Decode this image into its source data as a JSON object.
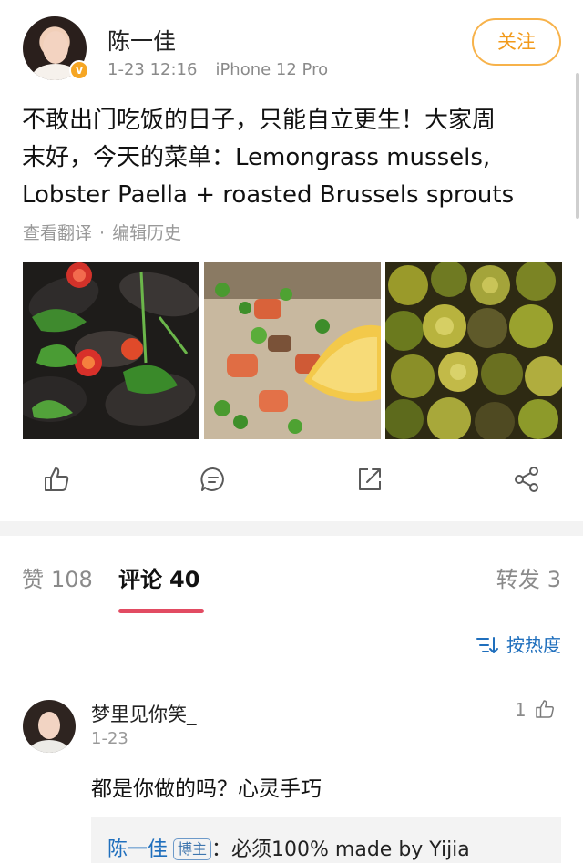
{
  "post": {
    "author": "陈一佳",
    "time": "1-23 12:16",
    "device": "iPhone 12 Pro",
    "follow_label": "关注",
    "verified_badge": "v",
    "text_lines": [
      "不敢出门吃饭的日子，只能自立更生！大家周",
      "末好，今天的菜单：Lemongrass mussels,",
      "Lobster Paella + roasted Brussels sprouts"
    ],
    "translate_label": "查看翻译",
    "separator": "·",
    "history_label": "编辑历史",
    "photos": [
      "mussels-photo",
      "paella-photo",
      "brussels-sprouts-photo"
    ]
  },
  "actions": [
    "like-icon",
    "comment-icon",
    "repost-icon",
    "share-icon"
  ],
  "tabs": {
    "likes_label": "赞",
    "likes_count": "108",
    "comments_label": "评论",
    "comments_count": "40",
    "reposts_label": "转发",
    "reposts_count": "3"
  },
  "sort_label": "按热度",
  "comment": {
    "author": "梦里见你笑_",
    "time": "1-23",
    "likes": "1",
    "text": "都是你做的吗？心灵手巧",
    "reply": {
      "author": "陈一佳",
      "badge": "博主",
      "text": "：必须100% made by Yijia"
    }
  },
  "colors": {
    "accent_orange": "#f29a1b",
    "link_blue": "#1f6fbd",
    "tab_underline": "#e24b62"
  }
}
